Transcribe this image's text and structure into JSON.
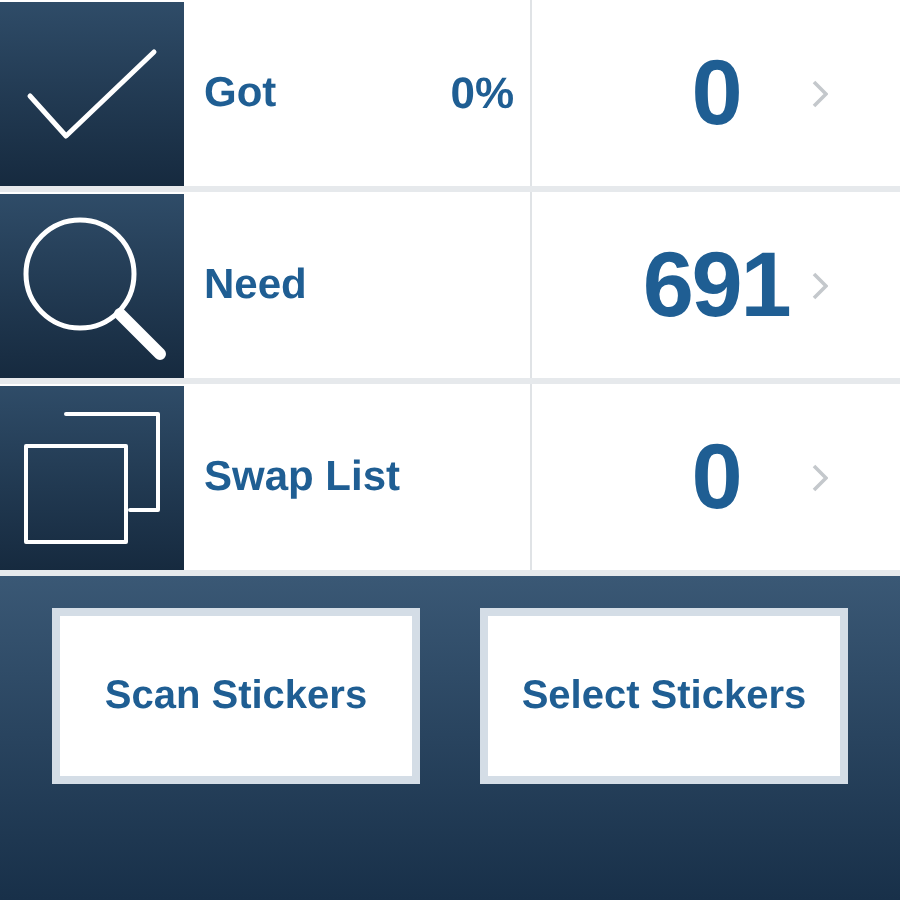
{
  "rows": [
    {
      "kind": "check",
      "label": "Got",
      "percent": "0%",
      "count": "0"
    },
    {
      "kind": "search",
      "label": "Need",
      "count": "691"
    },
    {
      "kind": "copies",
      "label": "Swap List",
      "count": "0"
    }
  ],
  "buttons": [
    "Scan Stickers",
    "Select Stickers"
  ]
}
